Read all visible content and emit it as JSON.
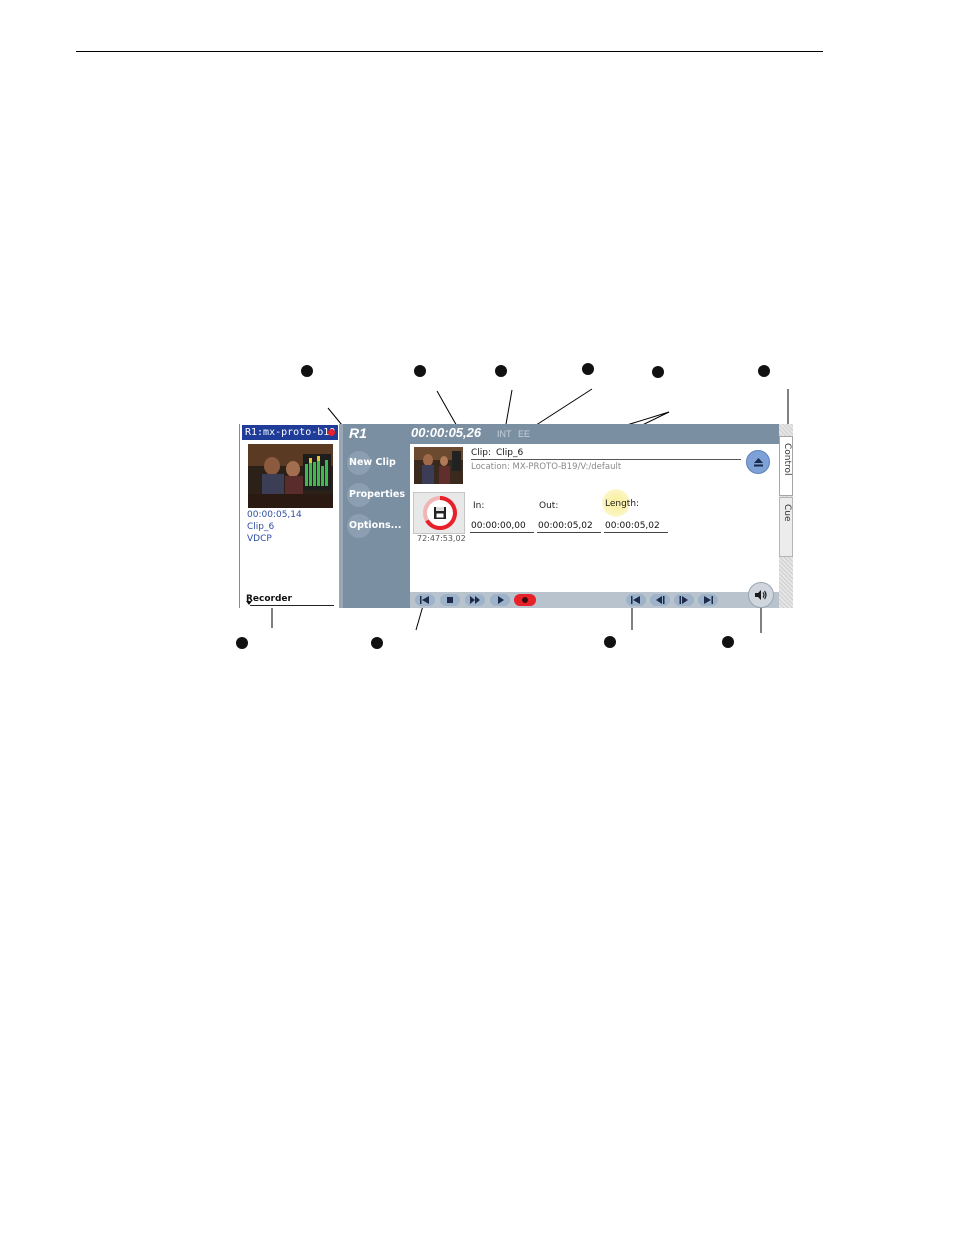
{
  "monitor": {
    "title": "R1:mx-proto-b19",
    "timecode": "00:00:05,14",
    "clip": "Clip_6",
    "protocol": "VDCP",
    "mode": "Recorder"
  },
  "sidebar": {
    "title": "R1",
    "buttons": [
      {
        "label": "New Clip"
      },
      {
        "label": "Properties"
      },
      {
        "label": "Options..."
      }
    ]
  },
  "header": {
    "timecode": "00:00:05,26",
    "mode_int": "INT",
    "mode_ee": "EE"
  },
  "clip": {
    "label": "Clip:",
    "name": "Clip_6",
    "location": "Location: MX-PROTO-B19/V:/default"
  },
  "record": {
    "time_remaining": "72:47:53,02"
  },
  "fields": {
    "in_label": "In:",
    "in_value": "00:00:00,00",
    "out_label": "Out:",
    "out_value": "00:00:05,02",
    "length_label": "Length:",
    "length_value": "00:00:05,02"
  },
  "tabs": {
    "control": "Control",
    "cue": "Cue"
  },
  "icons": {
    "eject": "eject-icon",
    "speaker": "speaker-icon",
    "record_disk": "disk-icon"
  },
  "colors": {
    "panel": "#7b8fa3",
    "title_bar": "#1f3c99",
    "record_red": "#e8202a"
  }
}
